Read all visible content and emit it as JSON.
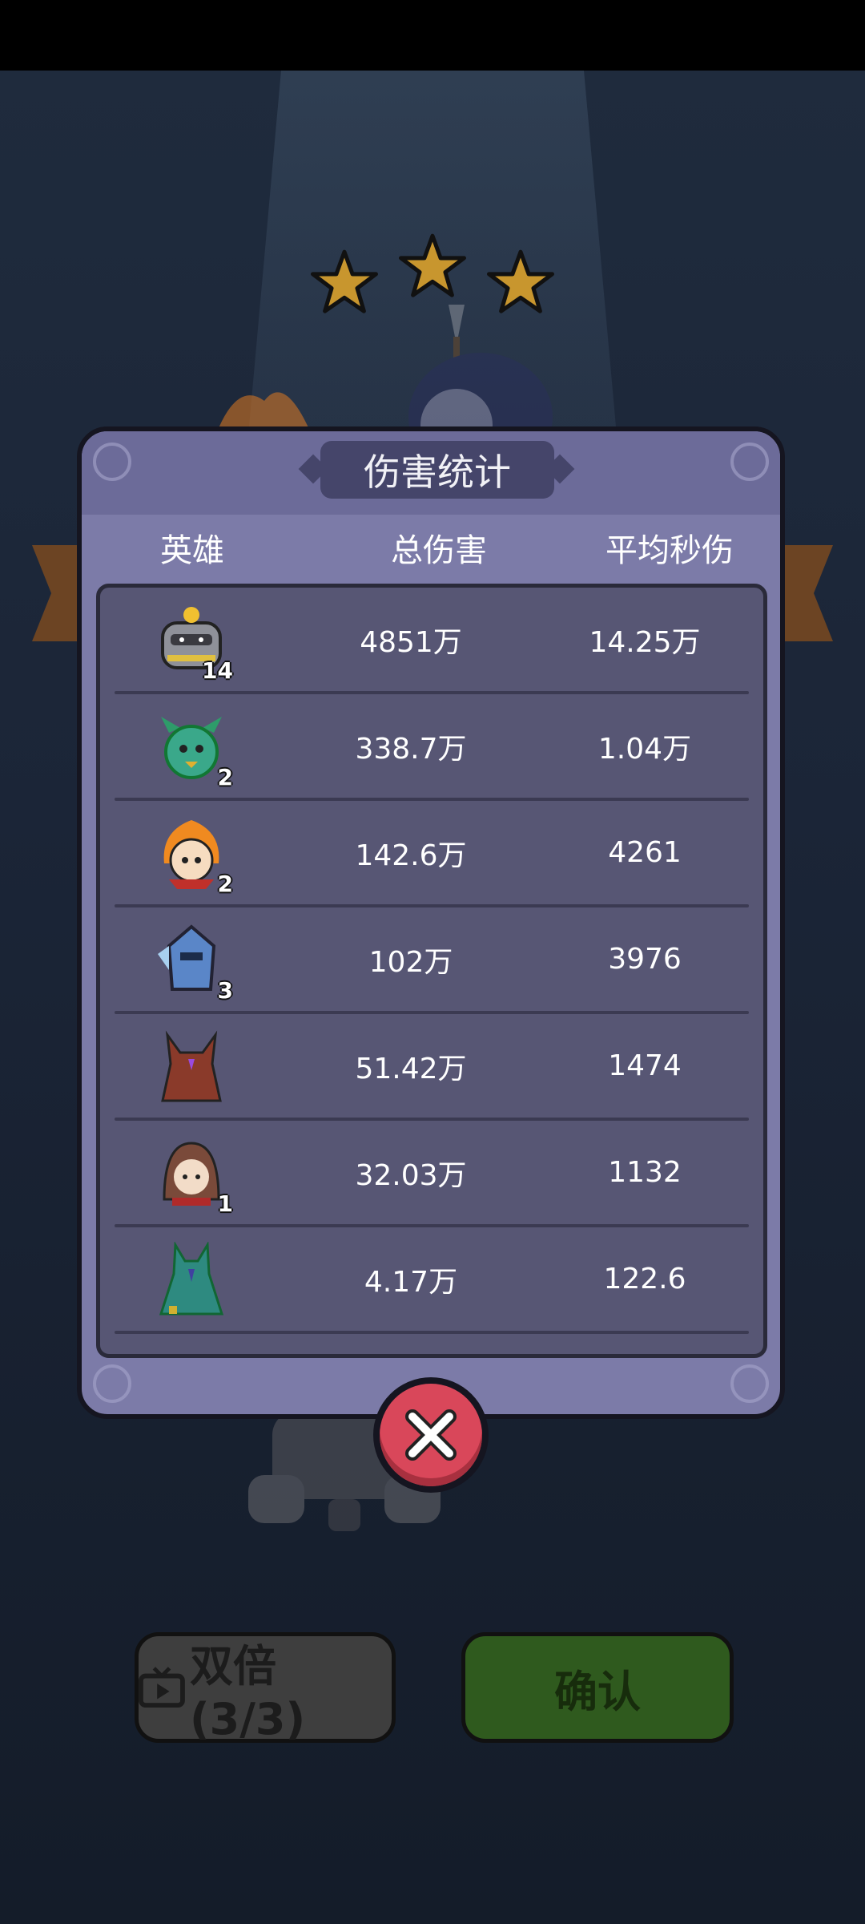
{
  "popup": {
    "title": "伤害统计",
    "columns": {
      "hero": "英雄",
      "total_damage": "总伤害",
      "avg_dps": "平均秒伤"
    },
    "rows": [
      {
        "hero_icon": "armored-knight-hero-icon",
        "level": "14",
        "total_damage": "4851万",
        "avg_dps": "14.25万"
      },
      {
        "hero_icon": "green-dragon-hero-icon",
        "level": "2",
        "total_damage": "338.7万",
        "avg_dps": "1.04万"
      },
      {
        "hero_icon": "fire-spirit-hero-icon",
        "level": "2",
        "total_damage": "142.6万",
        "avg_dps": "4261"
      },
      {
        "hero_icon": "ice-knight-hero-icon",
        "level": "3",
        "total_damage": "102万",
        "avg_dps": "3976"
      },
      {
        "hero_icon": "red-demon-hero-icon",
        "level": "",
        "total_damage": "51.42万",
        "avg_dps": "1474"
      },
      {
        "hero_icon": "hooded-rogue-hero-icon",
        "level": "1",
        "total_damage": "32.03万",
        "avg_dps": "1132"
      },
      {
        "hero_icon": "teal-golem-hero-icon",
        "level": "",
        "total_damage": "4.17万",
        "avg_dps": "122.6"
      }
    ],
    "close_icon": "close-icon"
  },
  "buttons": {
    "double_label": "双倍(3/3)",
    "confirm_label": "确认"
  },
  "stars": {
    "count": 3,
    "earned": 3
  },
  "colors": {
    "star": "#c8962e",
    "close": "#d9475a",
    "confirm": "#2f5a1e"
  }
}
